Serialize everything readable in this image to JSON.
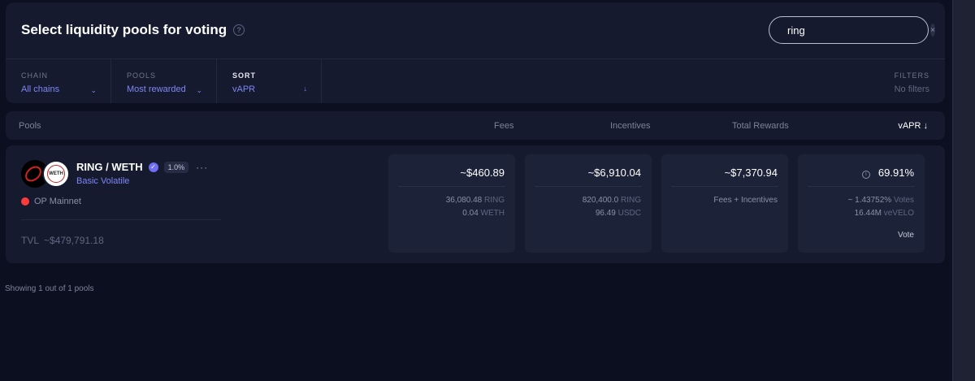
{
  "header": {
    "title": "Select liquidity pools for voting",
    "help_glyph": "?"
  },
  "search": {
    "value": "ring",
    "clear_glyph": "×"
  },
  "filters": {
    "chain": {
      "label": "CHAIN",
      "value": "All chains"
    },
    "pools": {
      "label": "POOLS",
      "value": "Most rewarded"
    },
    "sort": {
      "label": "SORT",
      "value": "vAPR",
      "arrow": "↓"
    },
    "filters": {
      "label": "FILTERS",
      "value": "No filters"
    }
  },
  "table": {
    "columns": {
      "pools": "Pools",
      "fees": "Fees",
      "incentives": "Incentives",
      "total_rewards": "Total Rewards",
      "vapr": "vAPR ↓"
    }
  },
  "pool": {
    "pair": "RING / WETH",
    "fee_badge": "1.0%",
    "more": "···",
    "type": "Basic Volatile",
    "chain": "OP Mainnet",
    "tvl_label": "TVL",
    "tvl_value": "~$479,791.18",
    "logo2_text": "WETH",
    "fees": {
      "total": "~$460.89",
      "line1_amount": "36,080.48",
      "line1_unit": "RING",
      "line2_amount": "0.04",
      "line2_unit": "WETH"
    },
    "incentives": {
      "total": "~$6,910.04",
      "line1_amount": "820,400.0",
      "line1_unit": "RING",
      "line2_amount": "96.49",
      "line2_unit": "USDC"
    },
    "total_rewards": {
      "total": "~$7,370.94",
      "line1": "Fees + Incentives"
    },
    "vapr": {
      "value": "69.91%",
      "votes_amount": "~ 1.43752%",
      "votes_unit": "Votes",
      "velo_amount": "16.44M",
      "velo_unit": "veVELO",
      "vote_label": "Vote"
    }
  },
  "footer": {
    "showing": "Showing 1 out of 1 pools"
  },
  "colors": {
    "background": "#0c0f1f",
    "panel": "#151a2e",
    "accent": "#7f86f5"
  }
}
